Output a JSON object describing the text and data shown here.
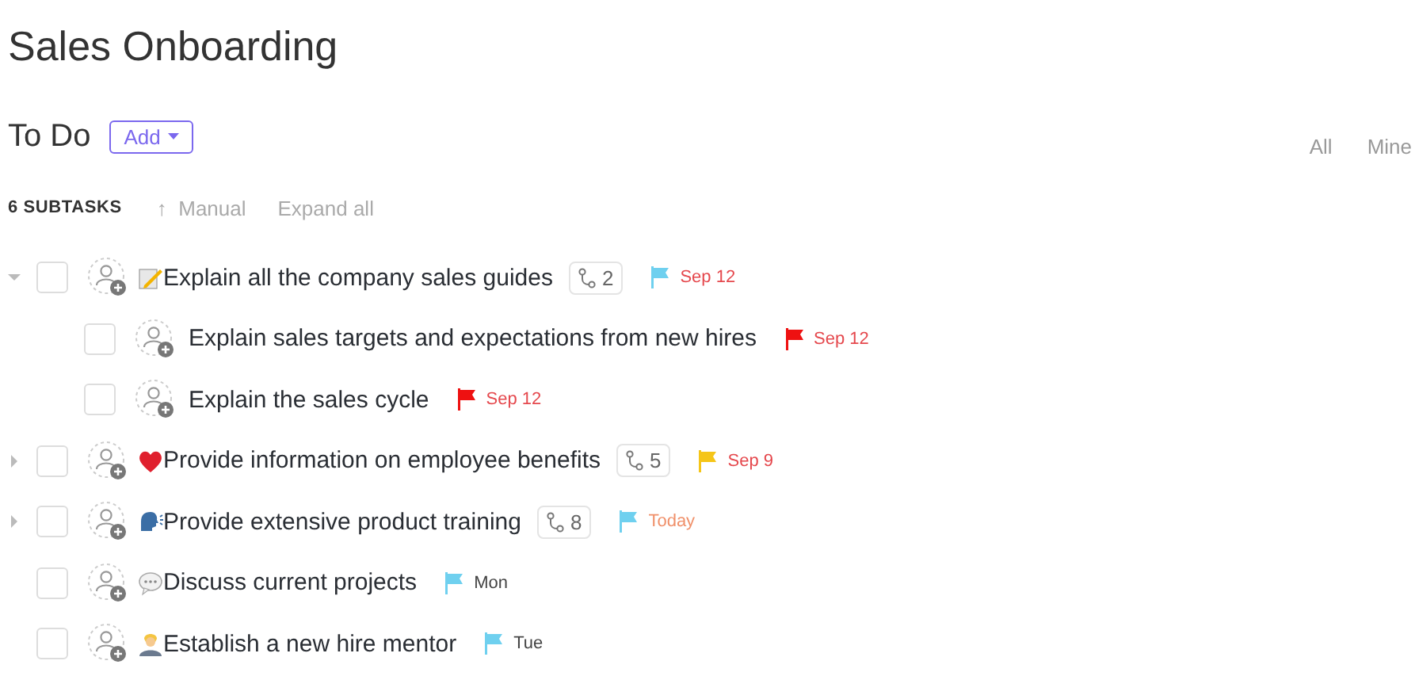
{
  "title": "Sales Onboarding",
  "group": {
    "name": "To Do",
    "add_label": "Add"
  },
  "filters": [
    {
      "label": "All",
      "selected": false
    },
    {
      "label": "Mine",
      "selected": false
    }
  ],
  "toolbar": {
    "count": "6 SUBTASKS",
    "sort_icon": "↑",
    "sort": "Manual",
    "expand": "Expand all"
  },
  "tasks": [
    {
      "kind": "memo",
      "checked": false,
      "name": "Explain all the company sales guides",
      "expanded": true,
      "subtask_count": "2",
      "flag": {
        "color": "#6fd0ef"
      },
      "date": {
        "text": "Sep 12",
        "color": "#e5484d"
      },
      "children": [
        {
          "kind": "plain",
          "checked": false,
          "name": "Explain sales targets and expectations from new hires",
          "flag": {
            "color": "#ee1111"
          },
          "date": {
            "text": "Sep 12",
            "color": "#e5484d"
          }
        },
        {
          "kind": "plain",
          "checked": false,
          "name": "Explain the sales cycle",
          "flag": {
            "color": "#ee1111"
          },
          "date": {
            "text": "Sep 12",
            "color": "#e5484d"
          }
        }
      ]
    },
    {
      "kind": "heart",
      "checked": false,
      "name": "Provide information on employee benefits",
      "expanded": false,
      "subtask_count": "5",
      "flag": {
        "color": "#f5c518"
      },
      "date": {
        "text": "Sep 9",
        "color": "#e5484d"
      }
    },
    {
      "kind": "speaker",
      "checked": false,
      "name": "Provide extensive product training",
      "expanded": false,
      "subtask_count": "8",
      "flag": {
        "color": "#6fd0ef"
      },
      "date": {
        "text": "Today",
        "color": "#f0906a"
      }
    },
    {
      "kind": "speech",
      "checked": false,
      "name": "Discuss current projects",
      "flag": {
        "color": "#6fd0ef"
      },
      "date": {
        "text": "Mon",
        "color": "#444444"
      }
    },
    {
      "kind": "person",
      "checked": false,
      "name": "Establish a new hire mentor",
      "flag": {
        "color": "#6fd0ef"
      },
      "date": {
        "text": "Tue",
        "color": "#444444"
      }
    }
  ]
}
